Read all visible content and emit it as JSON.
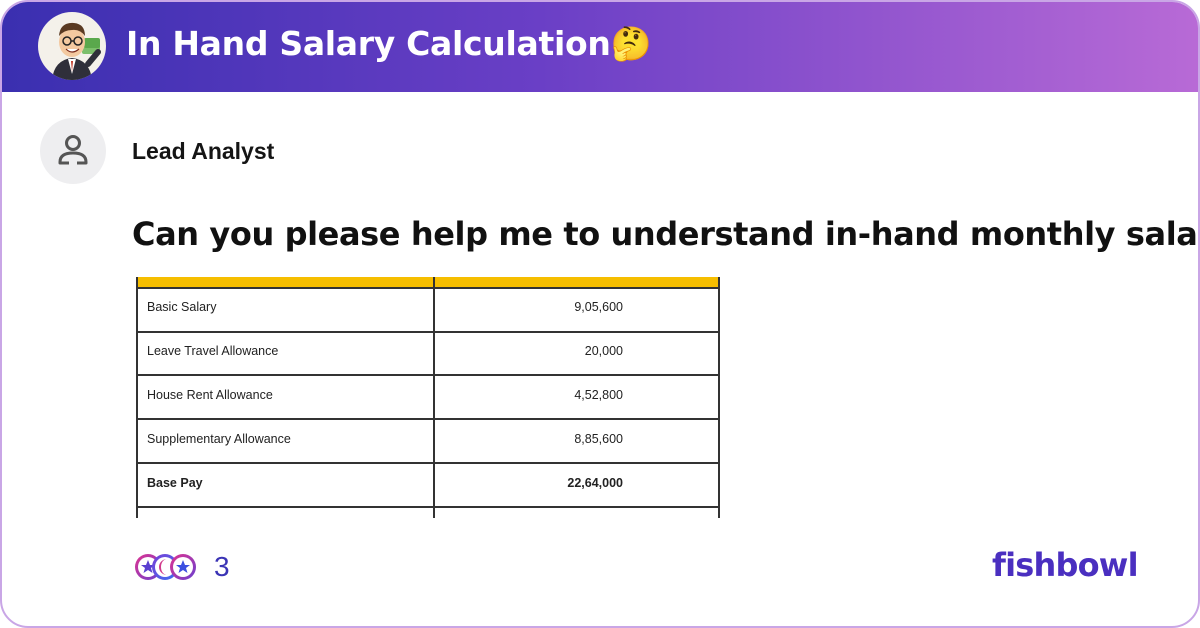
{
  "header": {
    "title": "In Hand Salary Calculation🤔",
    "bowl_icon": "cartoon-businessman-avatar",
    "gradient": [
      "#3a2fb0",
      "#6a3fc6",
      "#b86ad6"
    ]
  },
  "post": {
    "author_title": "Lead Analyst",
    "author_icon": "person-icon",
    "title": "Can you please help me to understand in-hand monthly salary..."
  },
  "salary_table": {
    "header_color": "#f6be00",
    "rows": [
      {
        "label": "Basic Salary",
        "value": "9,05,600",
        "bold": false
      },
      {
        "label": "Leave Travel Allowance",
        "value": "20,000",
        "bold": false
      },
      {
        "label": "House Rent Allowance",
        "value": "4,52,800",
        "bold": false
      },
      {
        "label": "Supplementary Allowance",
        "value": "8,85,600",
        "bold": false
      },
      {
        "label": "Base Pay",
        "value": "22,64,000",
        "bold": true
      }
    ]
  },
  "footer": {
    "reaction_icons": [
      "star-reaction-icon",
      "moon-reaction-icon",
      "star-reaction-icon"
    ],
    "reaction_count": "3",
    "brand": "fishbowl"
  }
}
